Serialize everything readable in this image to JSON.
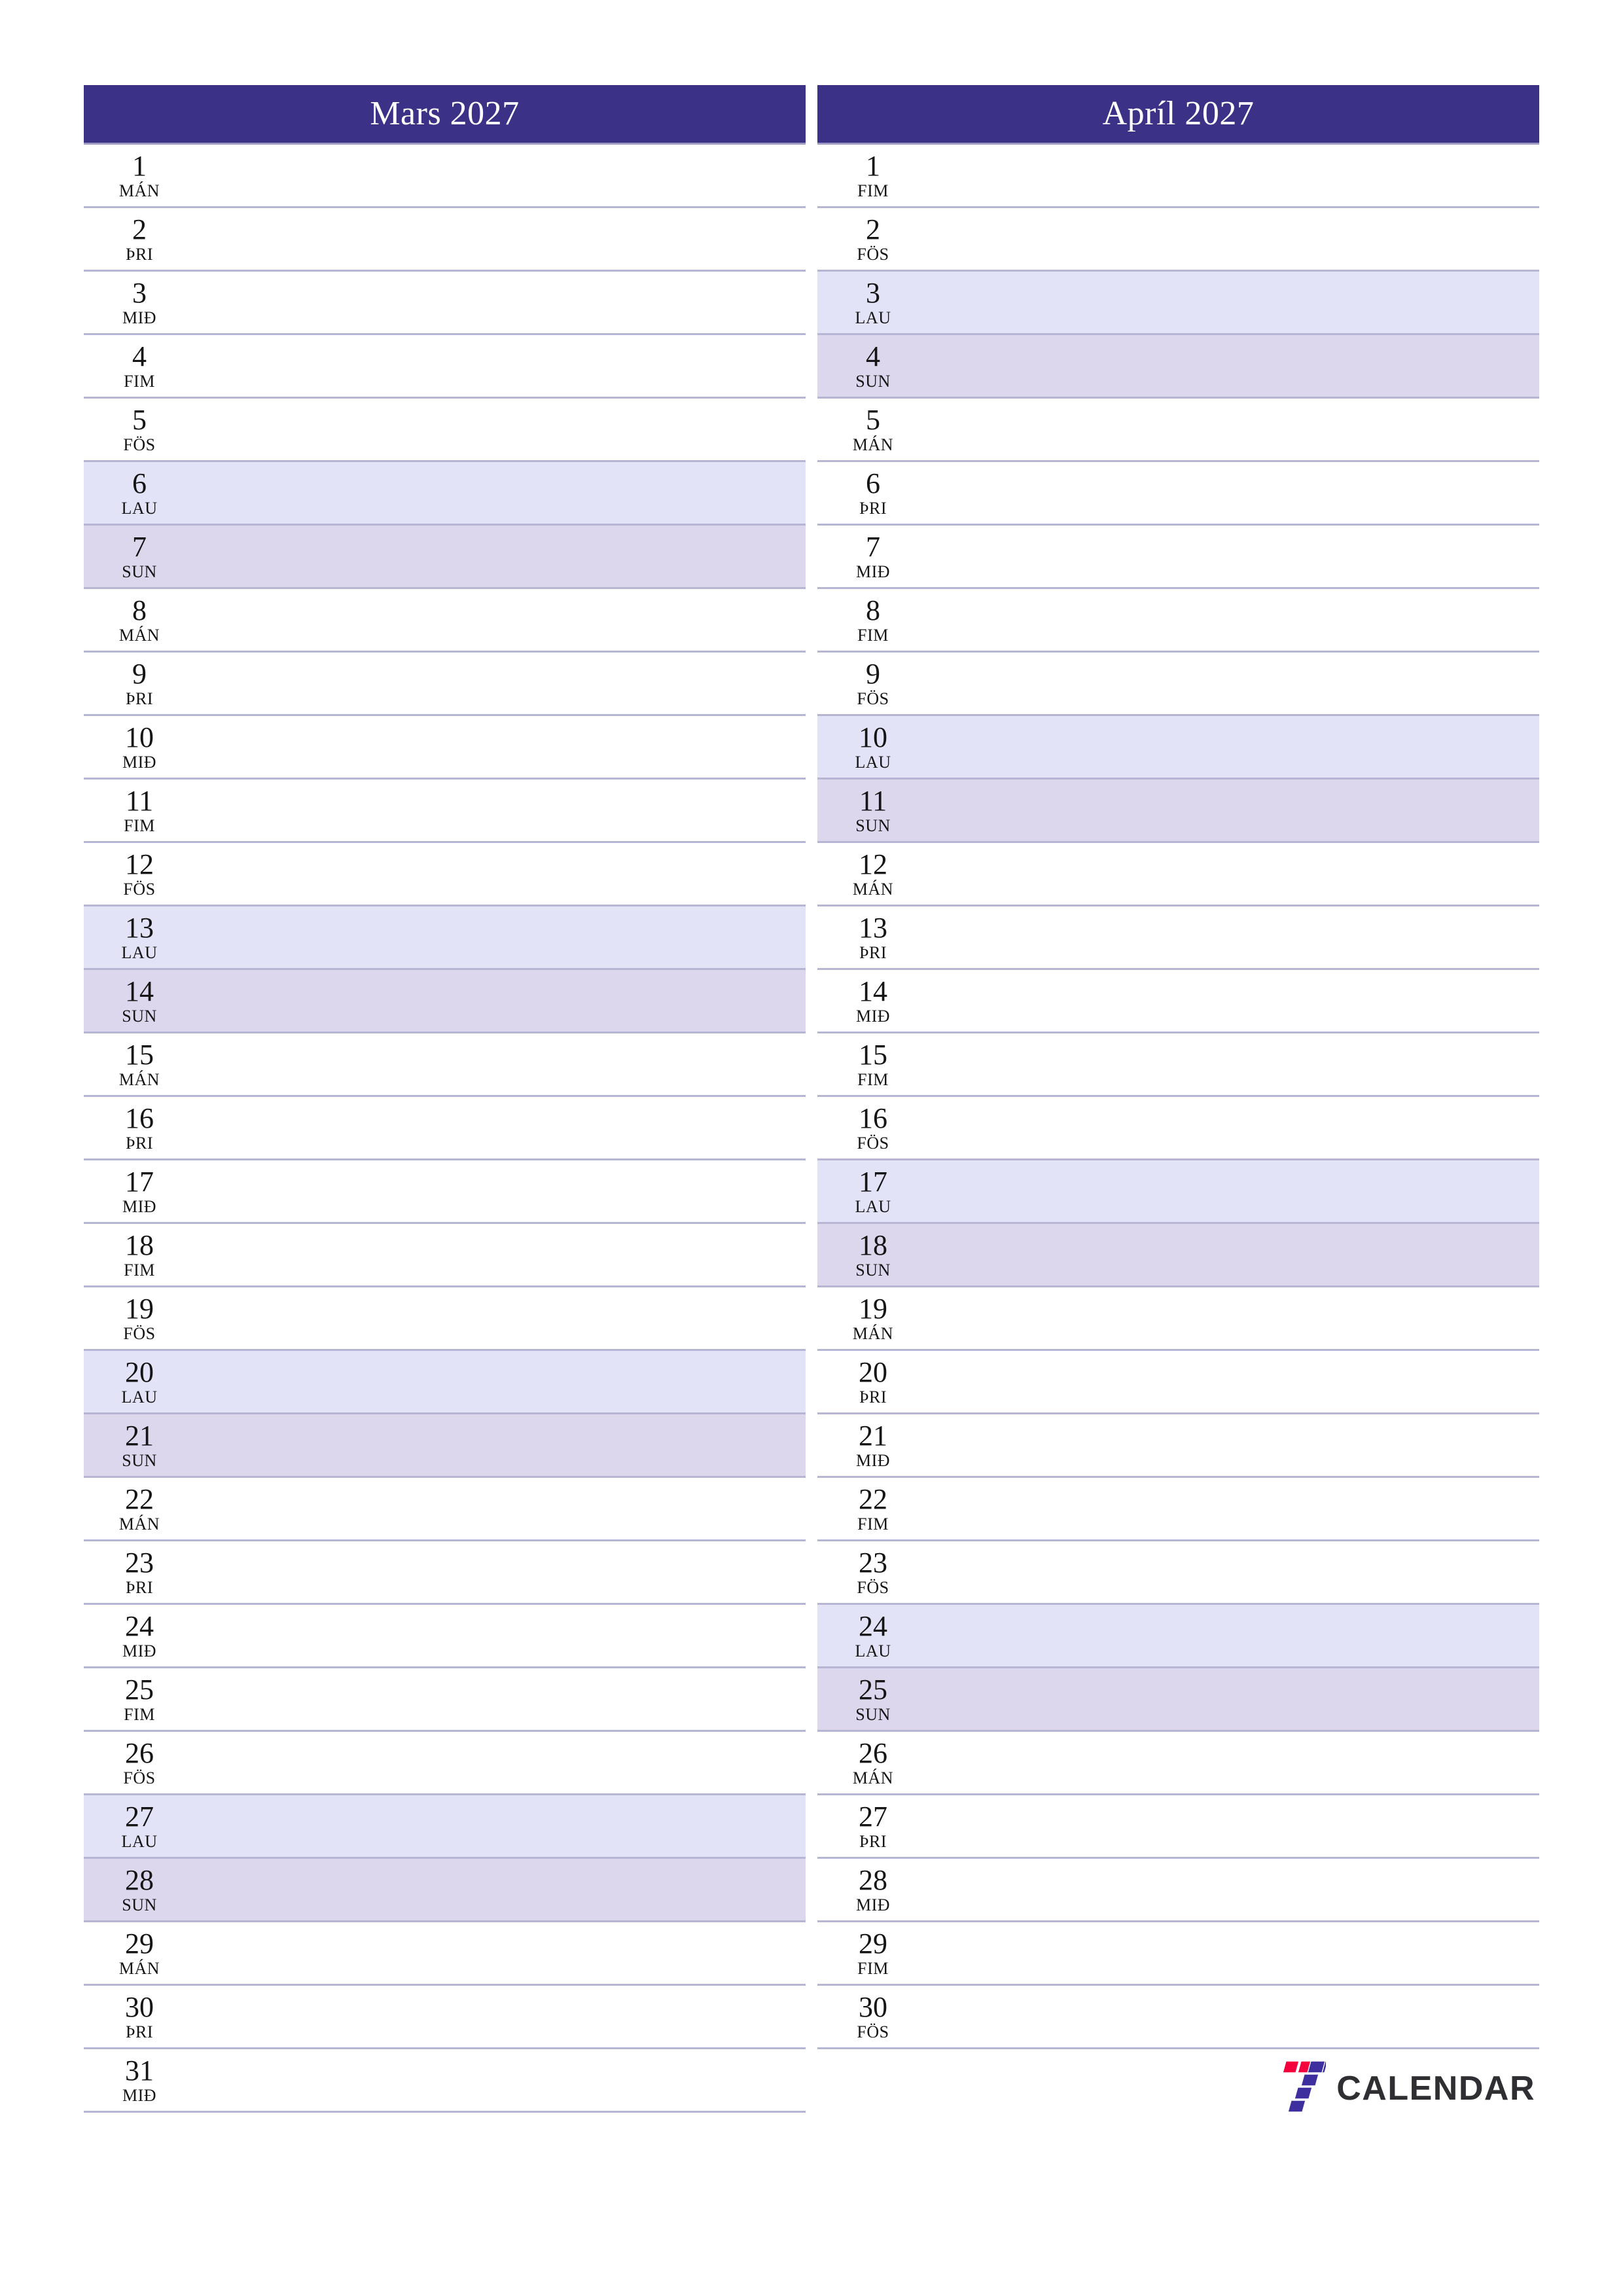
{
  "theme": {
    "header_bg": "#3b3287",
    "header_text": "#ffffff",
    "saturday_bg": "#e3e3f7",
    "sunday_bg": "#dcd7ec",
    "row_divider": "#b6b6d4",
    "day_text": "#151515",
    "brand_text_color": "#2e2e33",
    "brand_mark_purple": "#3d2f9e",
    "brand_mark_red": "#f5003c"
  },
  "brand": {
    "mark": "seven-logo-icon",
    "label": "CALENDAR"
  },
  "months": [
    {
      "title": "Mars 2027",
      "days": [
        {
          "num": "1",
          "wd": "MÁN",
          "kind": "weekday"
        },
        {
          "num": "2",
          "wd": "ÞRI",
          "kind": "weekday"
        },
        {
          "num": "3",
          "wd": "MIÐ",
          "kind": "weekday"
        },
        {
          "num": "4",
          "wd": "FIM",
          "kind": "weekday"
        },
        {
          "num": "5",
          "wd": "FÖS",
          "kind": "weekday"
        },
        {
          "num": "6",
          "wd": "LAU",
          "kind": "sat"
        },
        {
          "num": "7",
          "wd": "SUN",
          "kind": "sun"
        },
        {
          "num": "8",
          "wd": "MÁN",
          "kind": "weekday"
        },
        {
          "num": "9",
          "wd": "ÞRI",
          "kind": "weekday"
        },
        {
          "num": "10",
          "wd": "MIÐ",
          "kind": "weekday"
        },
        {
          "num": "11",
          "wd": "FIM",
          "kind": "weekday"
        },
        {
          "num": "12",
          "wd": "FÖS",
          "kind": "weekday"
        },
        {
          "num": "13",
          "wd": "LAU",
          "kind": "sat"
        },
        {
          "num": "14",
          "wd": "SUN",
          "kind": "sun"
        },
        {
          "num": "15",
          "wd": "MÁN",
          "kind": "weekday"
        },
        {
          "num": "16",
          "wd": "ÞRI",
          "kind": "weekday"
        },
        {
          "num": "17",
          "wd": "MIÐ",
          "kind": "weekday"
        },
        {
          "num": "18",
          "wd": "FIM",
          "kind": "weekday"
        },
        {
          "num": "19",
          "wd": "FÖS",
          "kind": "weekday"
        },
        {
          "num": "20",
          "wd": "LAU",
          "kind": "sat"
        },
        {
          "num": "21",
          "wd": "SUN",
          "kind": "sun"
        },
        {
          "num": "22",
          "wd": "MÁN",
          "kind": "weekday"
        },
        {
          "num": "23",
          "wd": "ÞRI",
          "kind": "weekday"
        },
        {
          "num": "24",
          "wd": "MIÐ",
          "kind": "weekday"
        },
        {
          "num": "25",
          "wd": "FIM",
          "kind": "weekday"
        },
        {
          "num": "26",
          "wd": "FÖS",
          "kind": "weekday"
        },
        {
          "num": "27",
          "wd": "LAU",
          "kind": "sat"
        },
        {
          "num": "28",
          "wd": "SUN",
          "kind": "sun"
        },
        {
          "num": "29",
          "wd": "MÁN",
          "kind": "weekday"
        },
        {
          "num": "30",
          "wd": "ÞRI",
          "kind": "weekday"
        },
        {
          "num": "31",
          "wd": "MIÐ",
          "kind": "weekday"
        }
      ],
      "show_brand": false
    },
    {
      "title": "Apríl 2027",
      "days": [
        {
          "num": "1",
          "wd": "FIM",
          "kind": "weekday"
        },
        {
          "num": "2",
          "wd": "FÖS",
          "kind": "weekday"
        },
        {
          "num": "3",
          "wd": "LAU",
          "kind": "sat"
        },
        {
          "num": "4",
          "wd": "SUN",
          "kind": "sun"
        },
        {
          "num": "5",
          "wd": "MÁN",
          "kind": "weekday"
        },
        {
          "num": "6",
          "wd": "ÞRI",
          "kind": "weekday"
        },
        {
          "num": "7",
          "wd": "MIÐ",
          "kind": "weekday"
        },
        {
          "num": "8",
          "wd": "FIM",
          "kind": "weekday"
        },
        {
          "num": "9",
          "wd": "FÖS",
          "kind": "weekday"
        },
        {
          "num": "10",
          "wd": "LAU",
          "kind": "sat"
        },
        {
          "num": "11",
          "wd": "SUN",
          "kind": "sun"
        },
        {
          "num": "12",
          "wd": "MÁN",
          "kind": "weekday"
        },
        {
          "num": "13",
          "wd": "ÞRI",
          "kind": "weekday"
        },
        {
          "num": "14",
          "wd": "MIÐ",
          "kind": "weekday"
        },
        {
          "num": "15",
          "wd": "FIM",
          "kind": "weekday"
        },
        {
          "num": "16",
          "wd": "FÖS",
          "kind": "weekday"
        },
        {
          "num": "17",
          "wd": "LAU",
          "kind": "sat"
        },
        {
          "num": "18",
          "wd": "SUN",
          "kind": "sun"
        },
        {
          "num": "19",
          "wd": "MÁN",
          "kind": "weekday"
        },
        {
          "num": "20",
          "wd": "ÞRI",
          "kind": "weekday"
        },
        {
          "num": "21",
          "wd": "MIÐ",
          "kind": "weekday"
        },
        {
          "num": "22",
          "wd": "FIM",
          "kind": "weekday"
        },
        {
          "num": "23",
          "wd": "FÖS",
          "kind": "weekday"
        },
        {
          "num": "24",
          "wd": "LAU",
          "kind": "sat"
        },
        {
          "num": "25",
          "wd": "SUN",
          "kind": "sun"
        },
        {
          "num": "26",
          "wd": "MÁN",
          "kind": "weekday"
        },
        {
          "num": "27",
          "wd": "ÞRI",
          "kind": "weekday"
        },
        {
          "num": "28",
          "wd": "MIÐ",
          "kind": "weekday"
        },
        {
          "num": "29",
          "wd": "FIM",
          "kind": "weekday"
        },
        {
          "num": "30",
          "wd": "FÖS",
          "kind": "weekday"
        }
      ],
      "show_brand": true
    }
  ]
}
